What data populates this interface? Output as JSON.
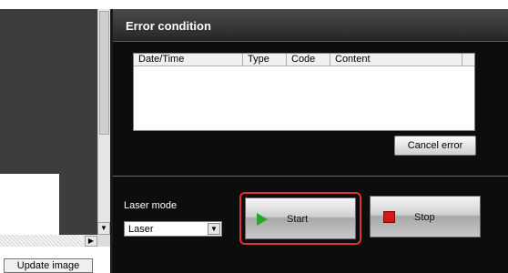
{
  "image_panel": {
    "update_button_label": "Update image",
    "scroll_down_glyph": "▼",
    "scroll_right_glyph": "▶"
  },
  "error_panel": {
    "title": "Error condition",
    "table": {
      "columns": [
        "Date/Time",
        "Type",
        "Code",
        "Content"
      ],
      "rows": []
    },
    "cancel_error_label": "Cancel error"
  },
  "laser_control": {
    "mode_label": "Laser mode",
    "mode_value": "Laser",
    "dropdown_glyph": "▼",
    "start_label": "Start",
    "stop_label": "Stop"
  },
  "colors": {
    "start_highlight": "#e0303a",
    "play_icon": "#28a428",
    "stop_icon": "#d21a1a"
  }
}
